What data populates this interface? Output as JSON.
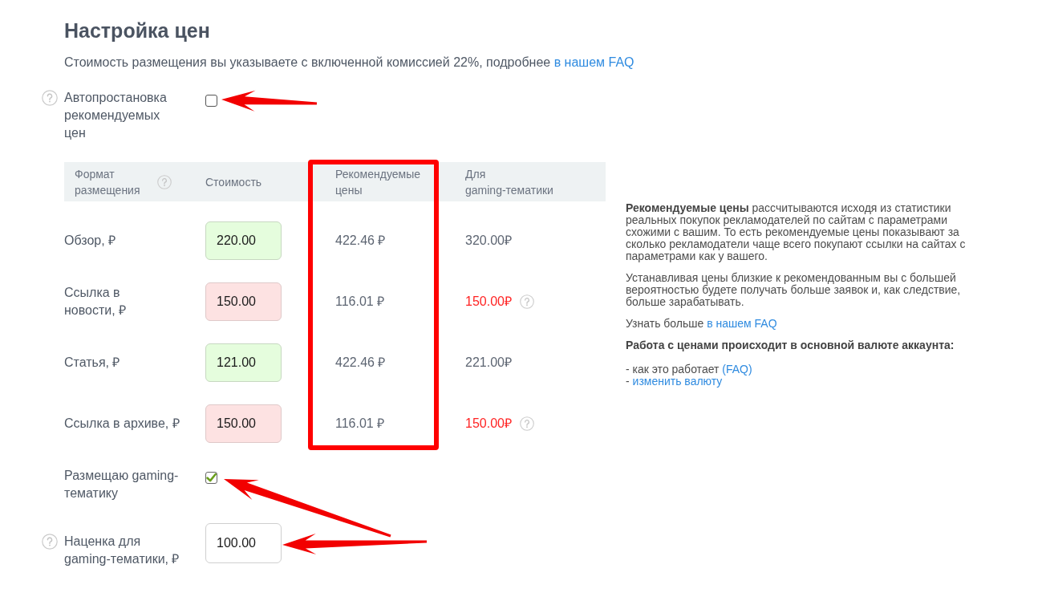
{
  "title": "Настройка цен",
  "intro": {
    "text": "Стоимость размещения вы указываете с включенной комиссией 22%, подробнее",
    "link": "в нашем FAQ"
  },
  "auto_pricing": {
    "label": "Автопростановка\nрекомендуемых\nцен",
    "help": true,
    "checked": false
  },
  "table": {
    "columns": [
      {
        "label": "Формат\nразмещения",
        "help": true,
        "highlighted": false
      },
      {
        "label": "Стоимость",
        "help": false,
        "highlighted": false
      },
      {
        "label": "Рекомендуемые\nцены",
        "help": false,
        "highlighted": true
      },
      {
        "label": "Для\ngaming-тематики",
        "help": false,
        "highlighted": false
      }
    ],
    "rows": [
      {
        "format": "Обзор, ₽",
        "price": "220.00",
        "above_recommended": false,
        "recommended": "422.46 ₽",
        "gaming": "320.00₽",
        "gaming_warning": false
      },
      {
        "format": "Ссылка в\nновости, ₽",
        "price": "150.00",
        "above_recommended": true,
        "recommended": "116.01 ₽",
        "gaming": "150.00₽",
        "gaming_warning": true
      },
      {
        "format": "Статья, ₽",
        "price": "121.00",
        "above_recommended": false,
        "recommended": "422.46 ₽",
        "gaming": "221.00₽",
        "gaming_warning": false
      },
      {
        "format": "Ссылка в архиве, ₽",
        "price": "150.00",
        "above_recommended": true,
        "recommended": "116.01 ₽",
        "gaming": "150.00₽",
        "gaming_warning": true
      }
    ]
  },
  "info": [
    {
      "kind": "paragraph",
      "text": "**Рекомендуемые цены** рассчитываются исходя из статистики реальных покупок рекламодателей по сайтам с параметрами схожими с вашим. То есть рекомендуемые цены показывают за сколько рекламодатели чаще всего покупают ссылки на сайтах с параметрами как у вашего."
    },
    {
      "kind": "paragraph",
      "text": "Устанавливая цены близкие к рекомендованным вы с большей вероятностью будете получать больше заявок и, как следствие, больше зарабатывать."
    },
    {
      "kind": "link_line",
      "text": "Узнать больше",
      "link": "в нашем FAQ"
    },
    {
      "kind": "heading",
      "text": "Работа с ценами происходит в основной валюте аккаунта:"
    },
    {
      "kind": "list",
      "items": [
        {
          "text": "- как это работает",
          "link": "(FAQ)"
        },
        {
          "text": "-",
          "link": "изменить валюту"
        }
      ]
    }
  ],
  "gaming": {
    "label": "Размещаю gaming-\nтематику",
    "help": false,
    "checked": true
  },
  "markup": {
    "label": "Наценка для\ngaming-тематики, ₽",
    "help": true,
    "value": "100.00"
  }
}
